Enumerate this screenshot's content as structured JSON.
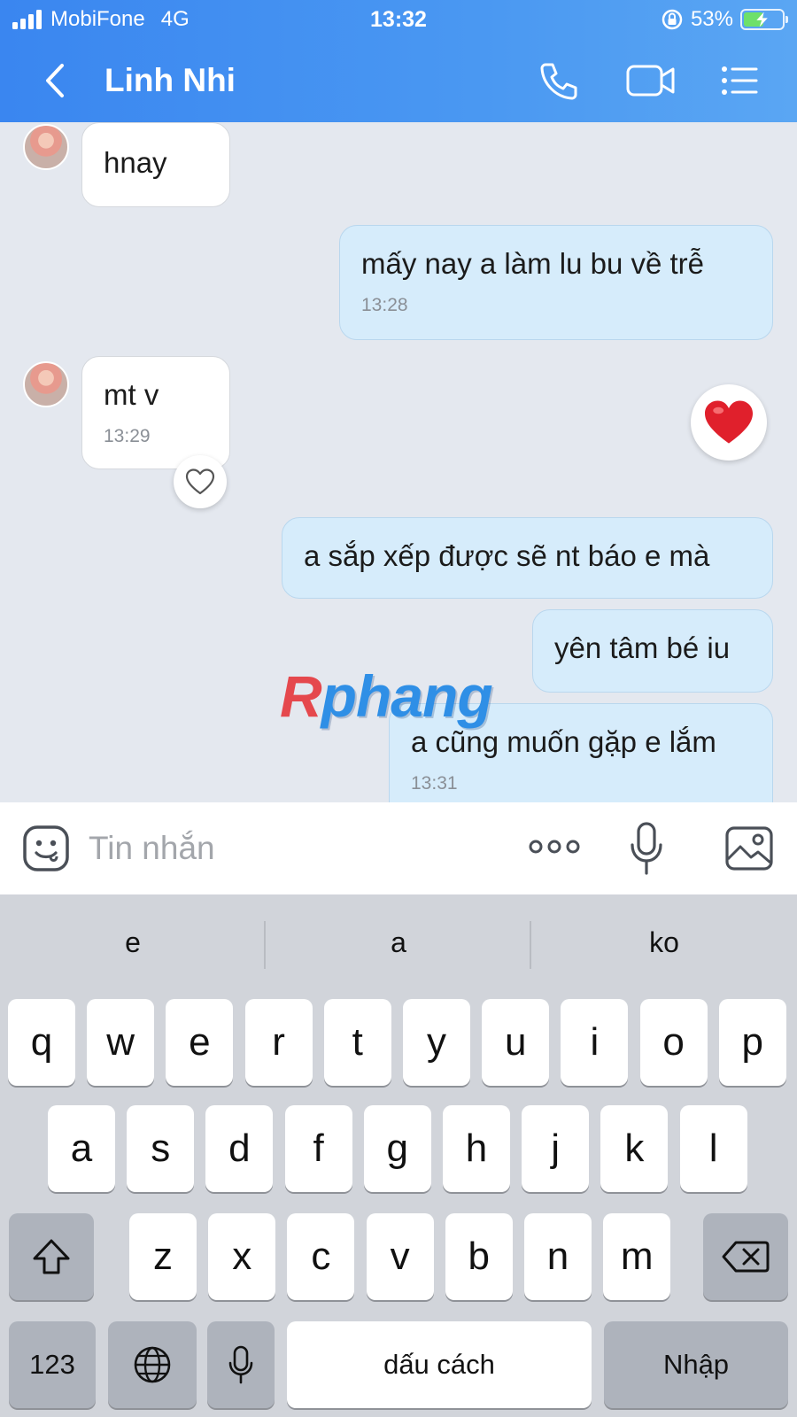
{
  "status_bar": {
    "carrier": "MobiFone",
    "network": "4G",
    "time": "13:32",
    "battery": "53%",
    "battery_level": 0.53
  },
  "header": {
    "title": "Linh Nhi",
    "icons": [
      "back-icon",
      "phone-icon",
      "video-call-icon",
      "menu-list-icon"
    ]
  },
  "messages": [
    {
      "direction": "in",
      "text": "hnay",
      "time": ""
    },
    {
      "direction": "out",
      "text": "mấy nay a làm lu bu về trễ",
      "time": "13:28"
    },
    {
      "direction": "in",
      "text": "mt v",
      "time": "13:29",
      "reaction": "heart-outline-icon"
    },
    {
      "direction": "out",
      "text": "a sắp xếp được sẽ nt báo e mà",
      "time": ""
    },
    {
      "direction": "out",
      "text": "yên tâm bé iu",
      "time": ""
    },
    {
      "direction": "out",
      "text": "a cũng muốn gặp e lắm",
      "time": "13:31"
    }
  ],
  "standalone_reaction": "red-heart-icon",
  "watermark": {
    "first": "R",
    "rest": "phang"
  },
  "input": {
    "placeholder": "Tin nhắn",
    "value": "",
    "icons": [
      "sticker-icon",
      "more-icon",
      "microphone-icon",
      "image-icon"
    ]
  },
  "keyboard": {
    "suggestions": [
      "e",
      "a",
      "ko"
    ],
    "row1": [
      "q",
      "w",
      "e",
      "r",
      "t",
      "y",
      "u",
      "i",
      "o",
      "p"
    ],
    "row2": [
      "a",
      "s",
      "d",
      "f",
      "g",
      "h",
      "j",
      "k",
      "l"
    ],
    "row3": [
      "z",
      "x",
      "c",
      "v",
      "b",
      "n",
      "m"
    ],
    "numbers_key": "123",
    "space_key": "dấu cách",
    "return_key": "Nhập",
    "icons": [
      "shift-icon",
      "backspace-icon",
      "globe-icon",
      "dictation-icon"
    ]
  }
}
